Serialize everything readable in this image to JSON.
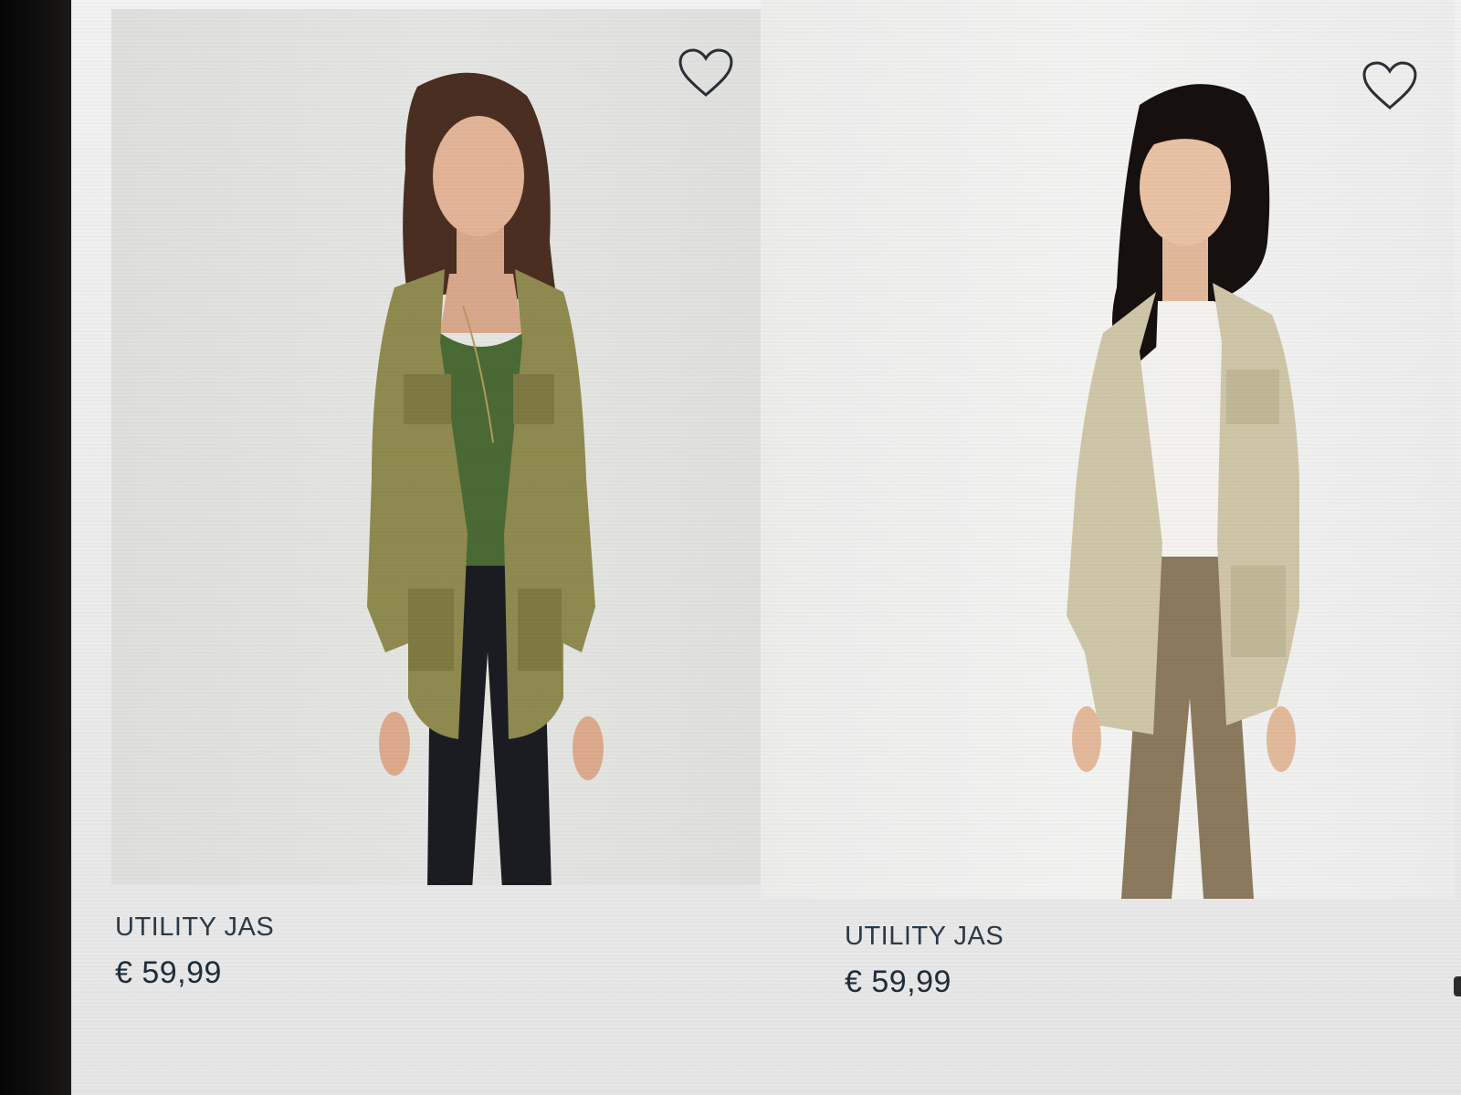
{
  "products": [
    {
      "name": "UTILITY JAS",
      "price": "€ 59,99",
      "favorite_icon": "heart-outline-icon",
      "jacket_color": "#8f8a4f",
      "top_color": "#4a6a35",
      "pants_color": "#1b1c22"
    },
    {
      "name": "UTILITY JAS",
      "price": "€ 59,99",
      "favorite_icon": "heart-outline-icon",
      "jacket_color": "#cfc6a8",
      "top_color": "#f4f3ef",
      "pants_color": "#8b7a5e"
    }
  ],
  "colors": {
    "text": "#2b3a49",
    "icon": "#2a2f36"
  }
}
